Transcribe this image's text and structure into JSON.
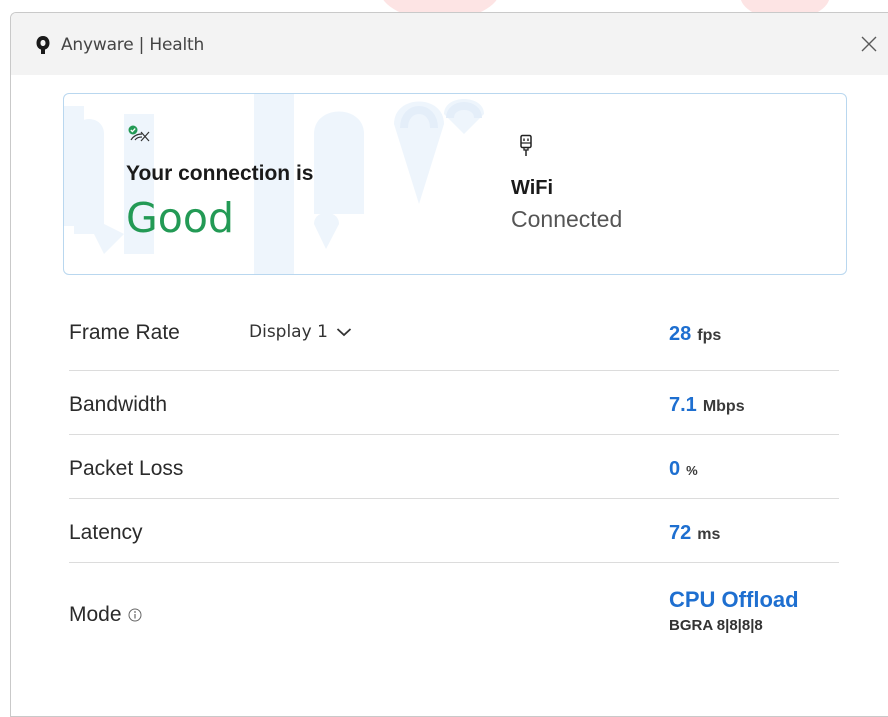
{
  "window": {
    "title": "Anyware | Health",
    "icon": "anyware-logo-icon",
    "close_icon": "close-icon"
  },
  "status": {
    "icon": "connection-status-icon",
    "heading": "Your connection is",
    "value": "Good",
    "value_color": "#239a55"
  },
  "network": {
    "icon": "ethernet-plug-icon",
    "type": "WiFi",
    "state": "Connected"
  },
  "metrics": {
    "frame_rate": {
      "label": "Frame Rate",
      "display_selector": "Display 1",
      "value": "28",
      "unit": "fps"
    },
    "bandwidth": {
      "label": "Bandwidth",
      "value": "7.1",
      "unit": "Mbps"
    },
    "packet_loss": {
      "label": "Packet Loss",
      "value": "0",
      "unit": "%"
    },
    "latency": {
      "label": "Latency",
      "value": "72",
      "unit": "ms"
    },
    "mode": {
      "label": "Mode",
      "info_icon": "info-icon",
      "primary": "CPU Offload",
      "secondary": "BGRA 8|8|8|8"
    }
  },
  "colors": {
    "accent": "#1e6fd0",
    "good": "#239a55",
    "card_border": "#b9d7ef"
  }
}
